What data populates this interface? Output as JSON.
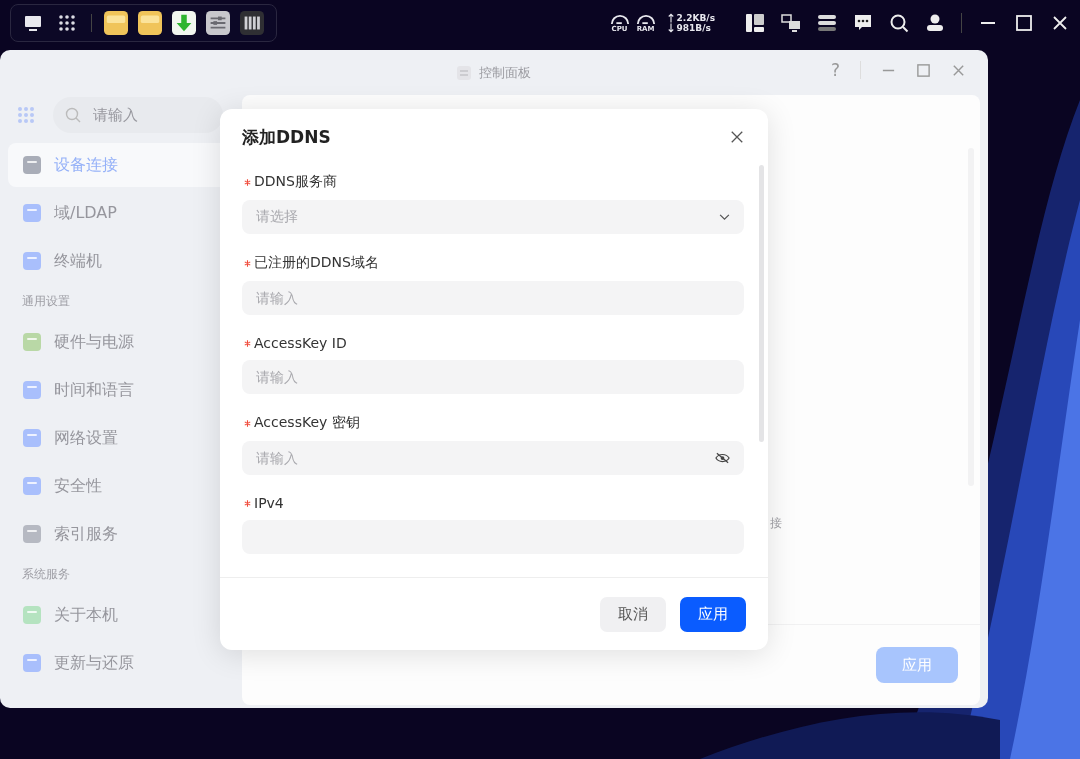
{
  "taskbar": {
    "meters": [
      {
        "label": "CPU"
      },
      {
        "label": "RAM"
      }
    ],
    "upload": "2.2KB/s",
    "download": "981B/s"
  },
  "window": {
    "title": "控制面板",
    "help": "?"
  },
  "sidebar": {
    "search": {
      "placeholder": "请输入"
    },
    "entries": [
      {
        "kind": "item",
        "label": "设备连接",
        "selected": true
      },
      {
        "kind": "item",
        "label": "域/LDAP",
        "selected": false
      },
      {
        "kind": "item",
        "label": "终端机",
        "selected": false
      },
      {
        "kind": "section",
        "label": "通用设置"
      },
      {
        "kind": "item",
        "label": "硬件与电源",
        "selected": false
      },
      {
        "kind": "item",
        "label": "时间和语言",
        "selected": false
      },
      {
        "kind": "item",
        "label": "网络设置",
        "selected": false
      },
      {
        "kind": "item",
        "label": "安全性",
        "selected": false
      },
      {
        "kind": "item",
        "label": "索引服务",
        "selected": false
      },
      {
        "kind": "section",
        "label": "系统服务"
      },
      {
        "kind": "item",
        "label": "关于本机",
        "selected": false
      },
      {
        "kind": "item",
        "label": "更新与还原",
        "selected": false
      }
    ]
  },
  "content": {
    "partial_text": "接",
    "apply_button": "应用"
  },
  "dialog": {
    "title": "添加DDNS",
    "fields": [
      {
        "kind": "select",
        "label": "DDNS服务商",
        "required": true,
        "placeholder": "请选择"
      },
      {
        "kind": "text",
        "label": "已注册的DDNS域名",
        "required": true,
        "placeholder": "请输入"
      },
      {
        "kind": "text",
        "label": "AccessKey ID",
        "required": true,
        "placeholder": "请输入"
      },
      {
        "kind": "password",
        "label": "AccessKey 密钥",
        "required": true,
        "placeholder": "请输入"
      },
      {
        "kind": "cut",
        "label": "IPv4",
        "required": true
      }
    ],
    "buttons": [
      {
        "label": "取消",
        "primary": false
      },
      {
        "label": "应用",
        "primary": true
      }
    ]
  }
}
